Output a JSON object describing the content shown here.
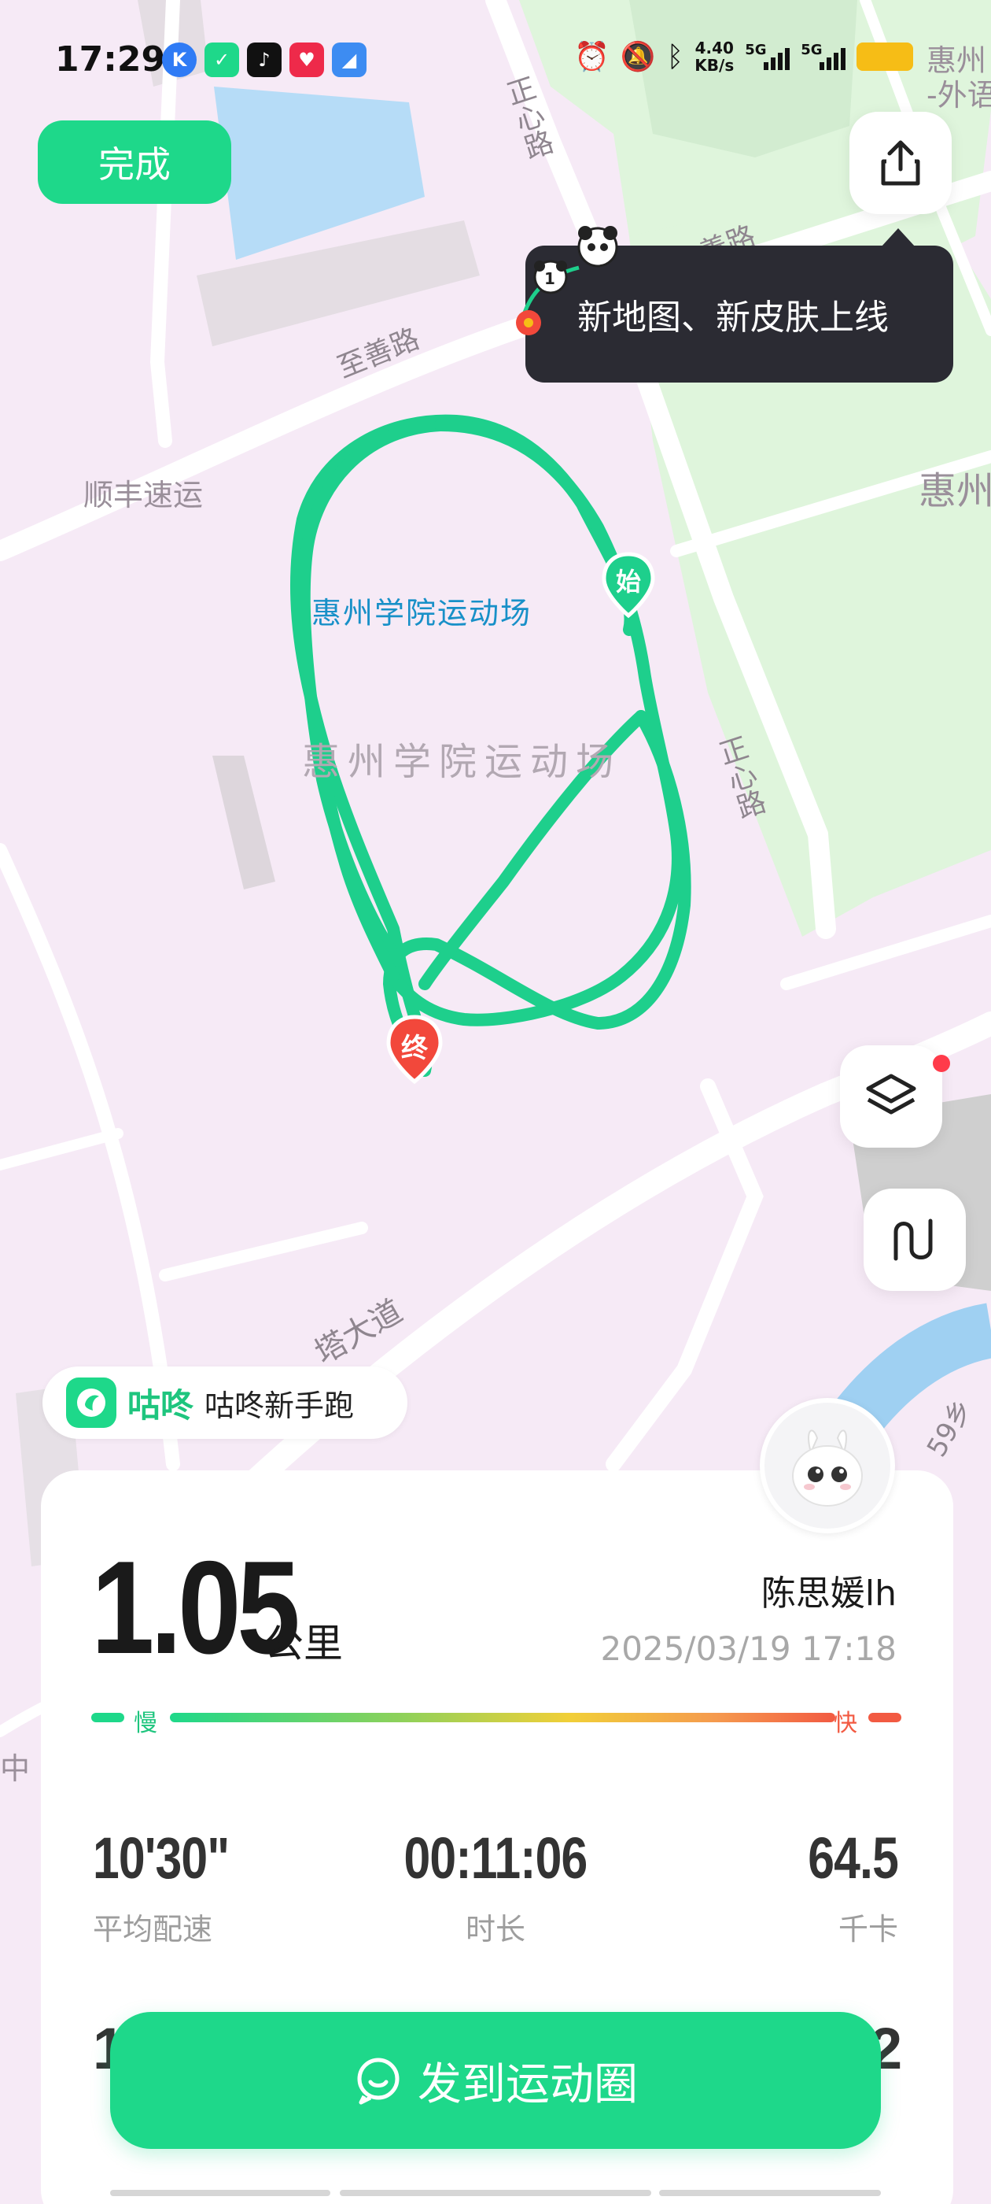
{
  "status_bar": {
    "time": "17:29",
    "net_speed_value": "4.40",
    "net_speed_unit": "KB/s",
    "network_1": "5G",
    "network_2": "5G"
  },
  "map": {
    "park_label": "惠州学院运动场",
    "area_label": "惠州学院运动场",
    "roads": {
      "zhixin_top": "正心路",
      "zhishan": "至善路",
      "zhishan_upper": "善路",
      "zhengxin_right": "正心路",
      "avenue": "塔大道",
      "number_road": "59乡"
    },
    "places": {
      "shunfeng": "顺丰速运",
      "huizhou_right": "惠州",
      "huizhou_top_right": "惠州",
      "foreign_lang": "-外语",
      "zhong_left": "中"
    },
    "markers": {
      "start": "始",
      "end": "终"
    }
  },
  "header": {
    "done_label": "完成",
    "tooltip_text": "新地图、新皮肤上线",
    "tooltip_badge": "1"
  },
  "source": {
    "brand": "咕咚",
    "plan": "咕咚新手跑"
  },
  "summary": {
    "distance": "1.05",
    "distance_unit": "公里",
    "username": "陈思媛lh",
    "datetime": "2025/03/19 17:18",
    "pace_slow_label": "慢",
    "pace_fast_label": "快",
    "stats": [
      {
        "value": "10'30\"",
        "label": "平均配速"
      },
      {
        "value": "00:11:06",
        "label": "时长"
      },
      {
        "value": "64.5",
        "label": "千卡"
      }
    ],
    "row2_peek_left": "1",
    "row2_peek_right": "2"
  },
  "actions": {
    "post_label": "发到运动圈"
  },
  "colors": {
    "accent": "#1ed88a",
    "track": "#1ecf8c",
    "end_marker": "#f2483b",
    "tooltip_bg": "#2b2b33"
  },
  "icons": {
    "share": "share-icon",
    "layers": "layers-icon",
    "route": "route-icon",
    "chat": "chat-bubble-icon"
  }
}
